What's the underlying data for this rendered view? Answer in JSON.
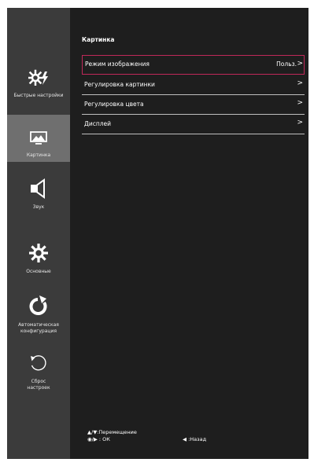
{
  "sidebar": {
    "items": [
      {
        "label": "Быстрые настройки",
        "icon": "quick-settings-icon"
      },
      {
        "label": "Картинка",
        "icon": "picture-icon",
        "active": true
      },
      {
        "label": "Звук",
        "icon": "speaker-icon"
      },
      {
        "label": "Основные",
        "icon": "gear-icon"
      },
      {
        "label": "Автоматическая конфигурация",
        "icon": "auto-config-icon"
      },
      {
        "label": "Сброс настроек",
        "icon": "reset-icon"
      }
    ]
  },
  "main": {
    "title": "Картинка",
    "rows": [
      {
        "label": "Режим изображения",
        "value": "Польз.",
        "arrow": ">"
      },
      {
        "label": "Регулировка картинки",
        "arrow": ">"
      },
      {
        "label": "Регулировка цвета",
        "arrow": ">"
      },
      {
        "label": "Дисплей",
        "arrow": ">"
      }
    ]
  },
  "footer": {
    "move_hint": "▲/▼:Перемещение",
    "ok_hint": "◉/▶ : ОК",
    "back_hint": "◀ :Назад"
  },
  "colors": {
    "background": "#1e1e1e",
    "sidebar": "#3b3b3b",
    "sidebar_active": "#6f6f6f",
    "highlight_border": "#c0285a"
  }
}
